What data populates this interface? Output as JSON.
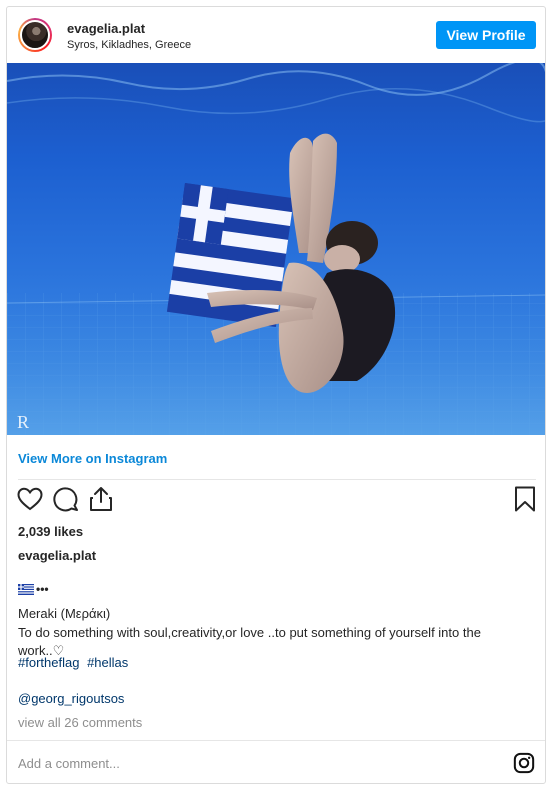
{
  "header": {
    "username": "evagelia.plat",
    "location": "Syros, Kikladhes, Greece",
    "view_profile_label": "View Profile"
  },
  "post": {
    "image_watermark": "R",
    "view_more_label": "View More on Instagram",
    "likes": "2,039 likes",
    "caption_username": "evagelia.plat",
    "caption_dots": "•••",
    "caption_title": "Meraki (Μεράκι)",
    "caption_body_line1": "To do something with soul,creativity,or love ..to put something of yourself into the",
    "caption_body_line2": "work..♡",
    "hashtags": [
      "#fortheflag",
      "#hellas"
    ],
    "mention": "@georg_rigoutsos",
    "comments_link": "view all 26 comments"
  },
  "comment_box": {
    "placeholder": "Add a comment..."
  },
  "icons": {
    "like": "heart-icon",
    "comment": "comment-icon",
    "share": "share-icon",
    "save": "bookmark-icon",
    "instagram": "instagram-logo-icon",
    "flag": "greek-flag-icon"
  },
  "colors": {
    "accent": "#0095f6",
    "link": "#0b88d8",
    "hashtag": "#00376b",
    "muted": "#8e8e8e"
  }
}
